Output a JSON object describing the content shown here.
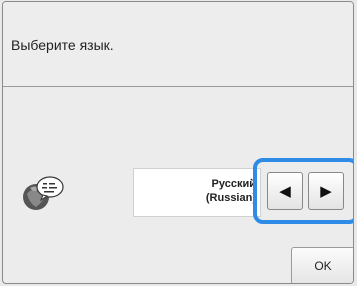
{
  "dialog": {
    "prompt": "Выберите язык."
  },
  "language": {
    "name": "Русский",
    "english_name": "(Russian)"
  },
  "buttons": {
    "prev_glyph": "◀",
    "next_glyph": "▶",
    "ok_label": "OK"
  },
  "colors": {
    "highlight": "#2e8be6"
  },
  "icons": {
    "language": "globe-speech-icon"
  }
}
